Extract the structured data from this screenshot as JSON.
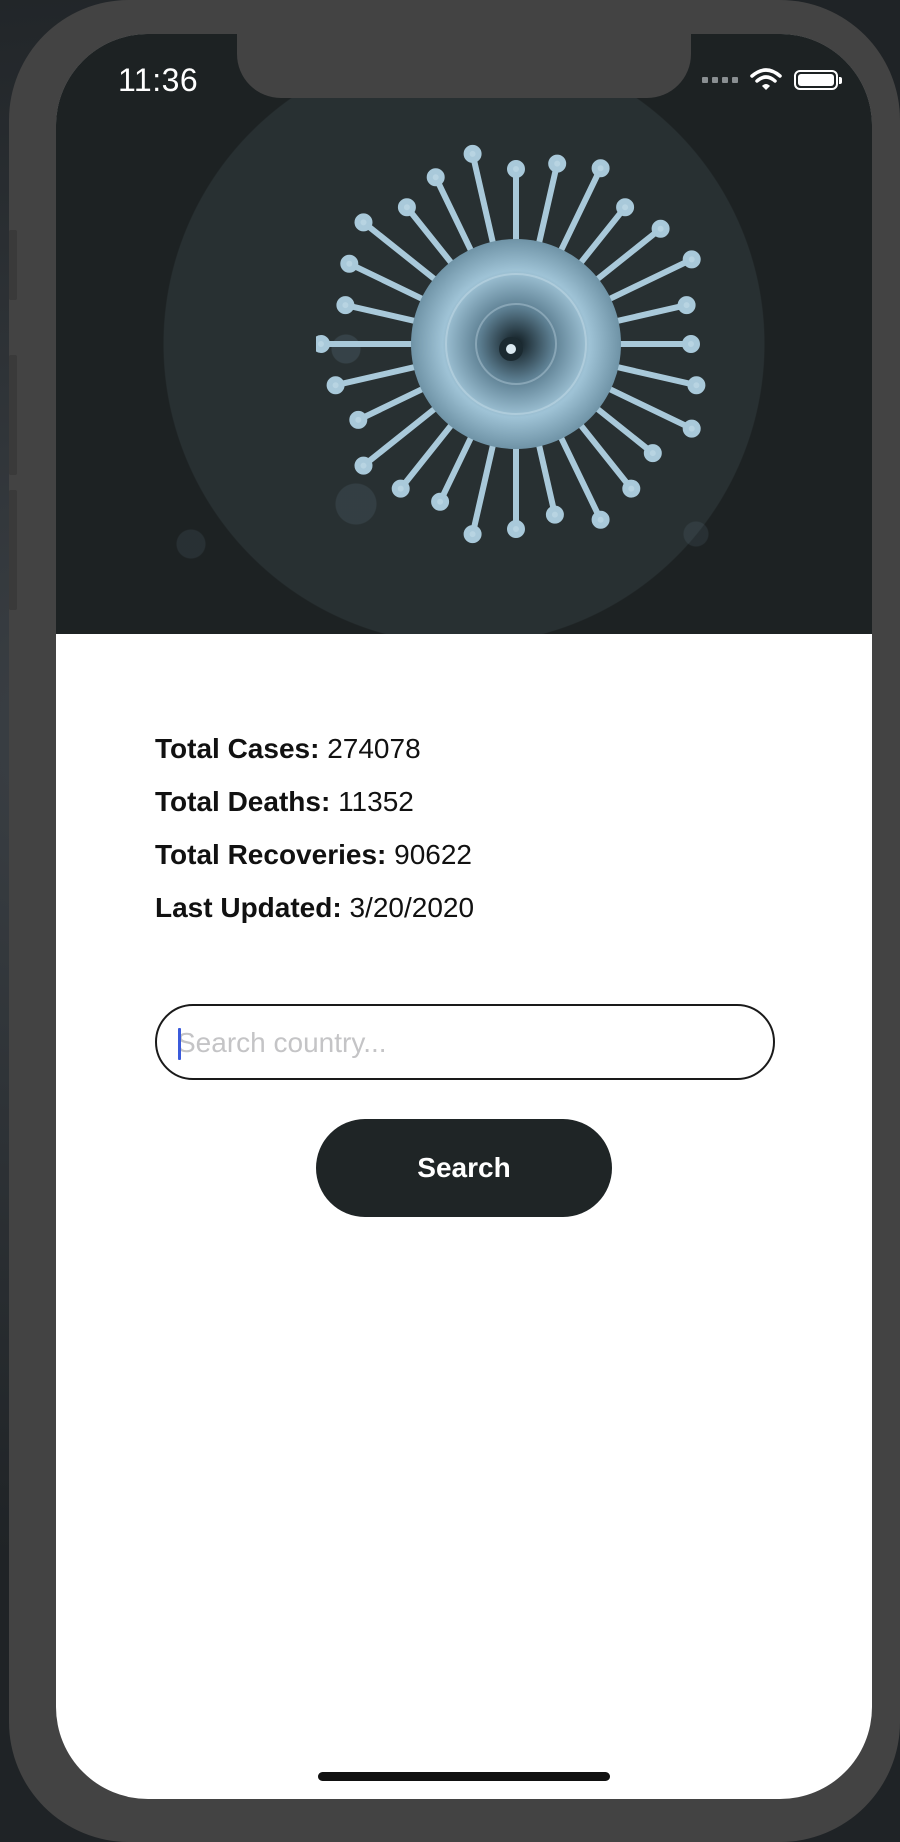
{
  "status_bar": {
    "time": "11:36"
  },
  "hero": {
    "image": "virus-illustration"
  },
  "stats": [
    {
      "label": "Total Cases:",
      "value": "274078"
    },
    {
      "label": "Total Deaths:",
      "value": "11352"
    },
    {
      "label": "Total Recoveries:",
      "value": "90622"
    },
    {
      "label": "Last Updated:",
      "value": "3/20/2020"
    }
  ],
  "search": {
    "placeholder": "Search country...",
    "value": "",
    "button_label": "Search"
  },
  "colors": {
    "dark": "#1f2526",
    "frame": "#434343",
    "caret": "#3b5bdb"
  }
}
